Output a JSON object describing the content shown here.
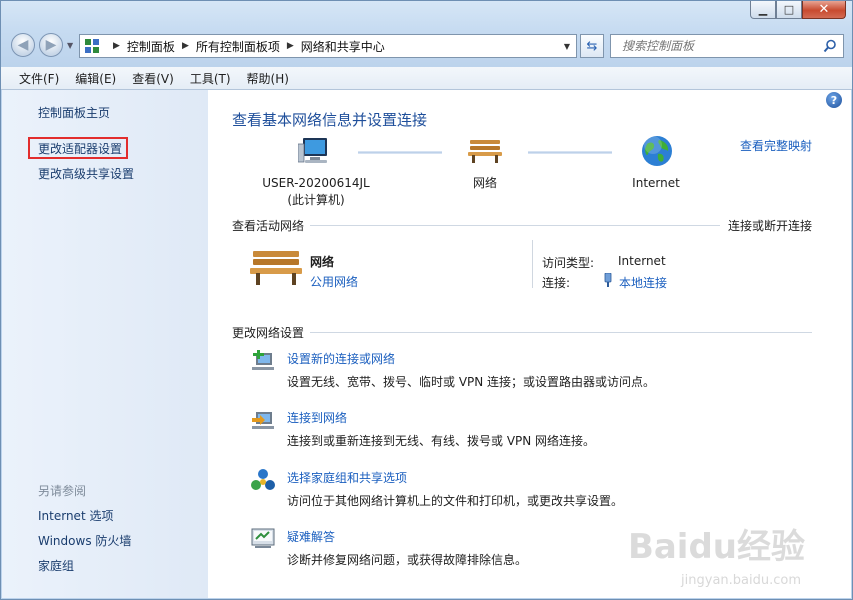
{
  "window": {
    "min": "▁",
    "max": "□",
    "close": "✕"
  },
  "nav": {
    "breadcrumb": [
      "控制面板",
      "所有控制面板项",
      "网络和共享中心"
    ],
    "search_placeholder": "搜索控制面板"
  },
  "menu": [
    "文件(F)",
    "编辑(E)",
    "查看(V)",
    "工具(T)",
    "帮助(H)"
  ],
  "sidebar": {
    "home": "控制面板主页",
    "adapter": "更改适配器设置",
    "advanced": "更改高级共享设置",
    "see_also": "另请参阅",
    "links": [
      "Internet 选项",
      "Windows 防火墙",
      "家庭组"
    ]
  },
  "main": {
    "title": "查看基本网络信息并设置连接",
    "full_map": "查看完整映射",
    "computer_name": "USER-20200614JL",
    "computer_sub": "(此计算机)",
    "network_label": "网络",
    "internet_label": "Internet",
    "active_header": "查看活动网络",
    "connect_disconnect": "连接或断开连接",
    "active": {
      "name": "网络",
      "type": "公用网络",
      "access_label": "访问类型:",
      "access_value": "Internet",
      "conn_label": "连接:",
      "conn_value": "本地连接"
    },
    "change_header": "更改网络设置",
    "tasks": [
      {
        "title": "设置新的连接或网络",
        "desc": "设置无线、宽带、拨号、临时或 VPN 连接；或设置路由器或访问点。"
      },
      {
        "title": "连接到网络",
        "desc": "连接到或重新连接到无线、有线、拨号或 VPN 网络连接。"
      },
      {
        "title": "选择家庭组和共享选项",
        "desc": "访问位于其他网络计算机上的文件和打印机，或更改共享设置。"
      },
      {
        "title": "疑难解答",
        "desc": "诊断并修复网络问题，或获得故障排除信息。"
      }
    ],
    "help": "?"
  },
  "watermark": {
    "main": "Baidu经验",
    "sub": "jingyan.baidu.com"
  }
}
